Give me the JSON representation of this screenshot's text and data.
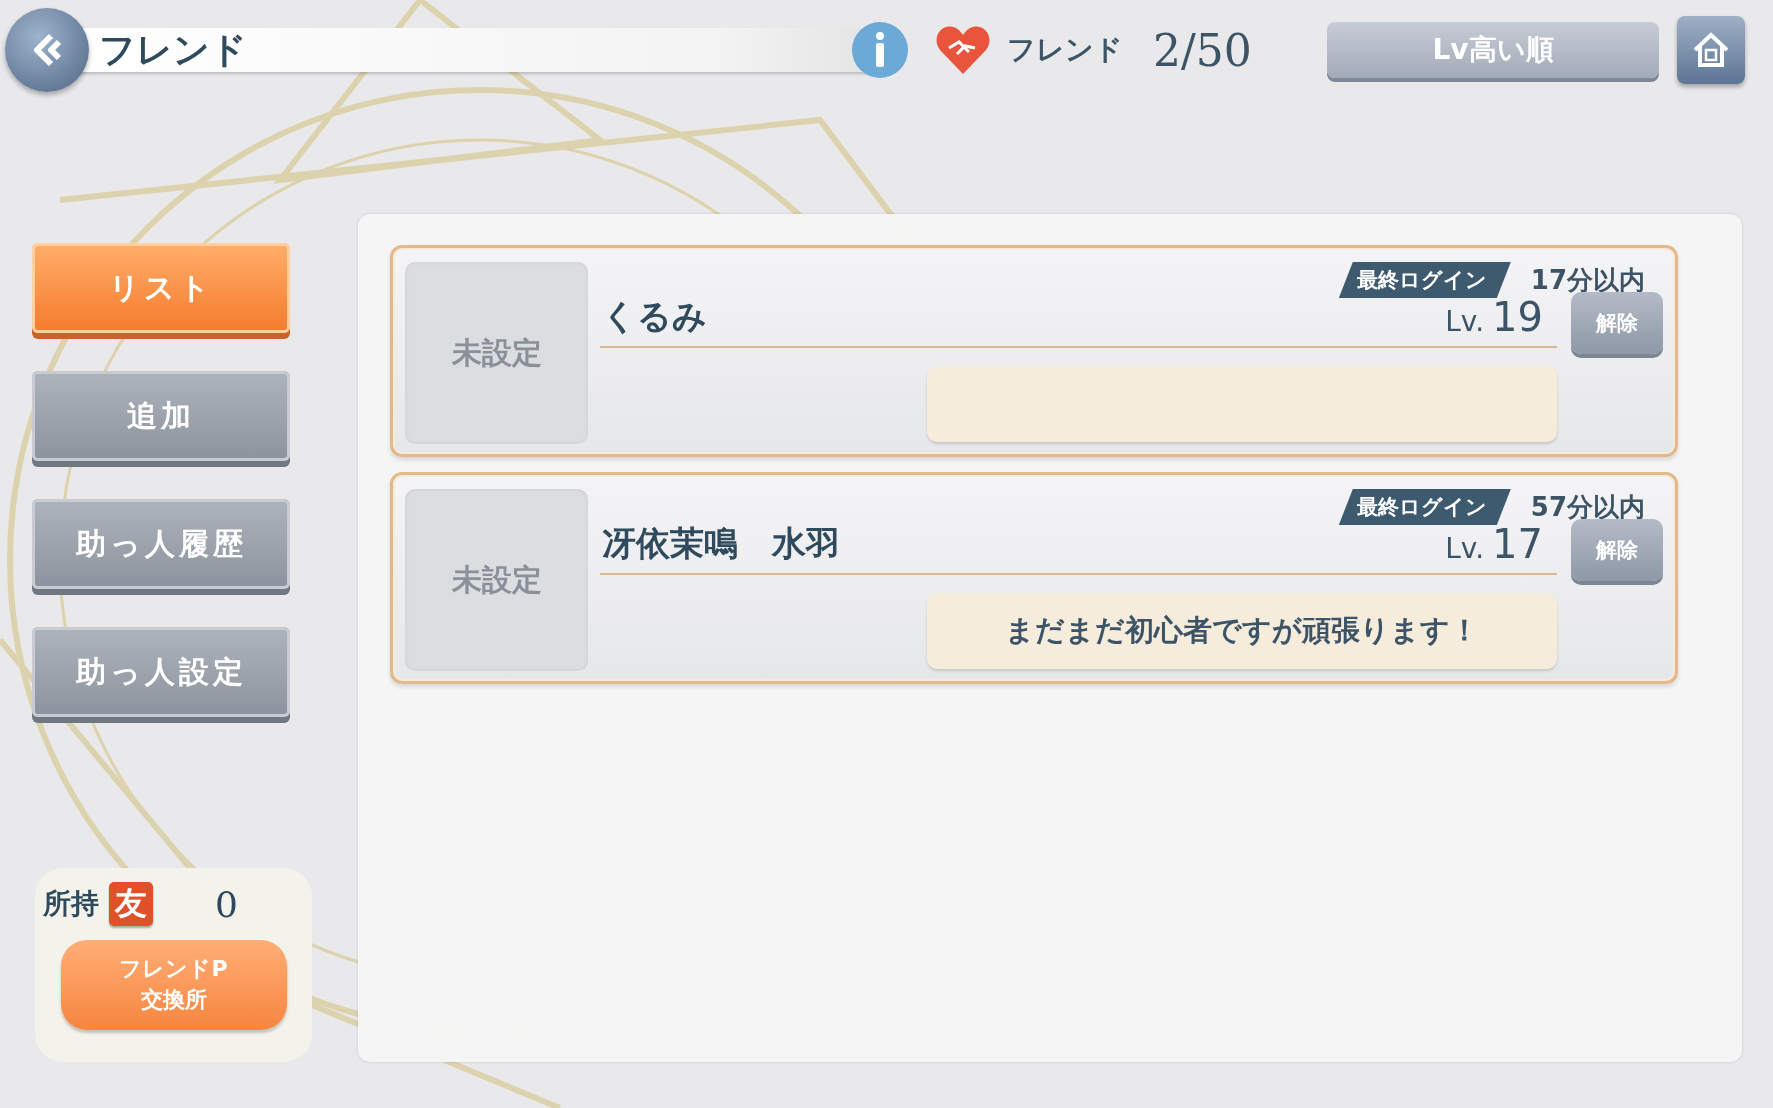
{
  "header": {
    "title": "フレンド"
  },
  "friend_count": {
    "label": "フレンド",
    "value": "2/50"
  },
  "sort_button": "Lv高い順",
  "side_menu": [
    {
      "label": "リスト",
      "selected": true
    },
    {
      "label": "追加",
      "selected": false
    },
    {
      "label": "助っ人履歴",
      "selected": false
    },
    {
      "label": "助っ人設定",
      "selected": false
    }
  ],
  "friends": [
    {
      "avatar": "未設定",
      "last_login_label": "最終ログイン",
      "last_login": "17分以内",
      "name": "くるみ",
      "level_label": "Lv.",
      "level": "19",
      "remove_button": "解除"
    },
    {
      "avatar": "未設定",
      "last_login_label": "最終ログイン",
      "last_login": "57分以内",
      "name": "冴依茉鳴　水羽",
      "level_label": "Lv.",
      "level": "17",
      "remove_button": "解除",
      "message": "まだまだ初心者ですが頑張ります！"
    }
  ],
  "points": {
    "label": "所持",
    "badge": "友",
    "value": "0",
    "exchange_button": [
      "フレンドP",
      "交換所"
    ]
  }
}
